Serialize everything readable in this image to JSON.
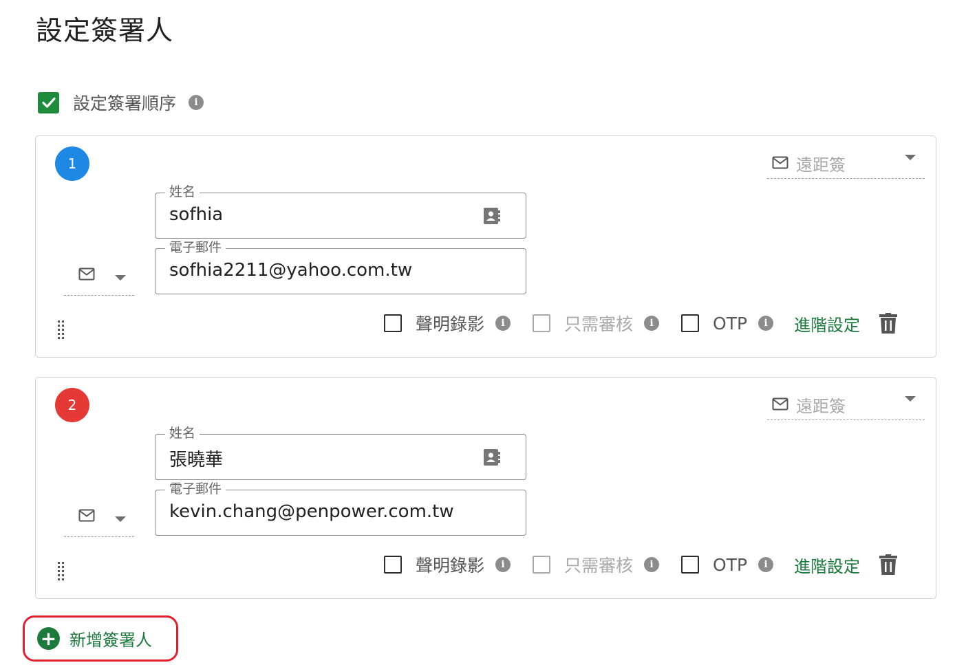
{
  "page_title": "設定簽署人",
  "signing_order": {
    "label": "設定簽署順序",
    "checked": true
  },
  "colors": {
    "accent_green": "#1b7a3c",
    "badge_blue": "#1e88e5",
    "badge_red": "#e53935",
    "highlight_red": "#e0202f"
  },
  "signers": [
    {
      "number": "1",
      "badge_color": "#1e88e5",
      "method": "遠距簽",
      "name_label": "姓名",
      "name_value": "sofhia",
      "email_label": "電子郵件",
      "email_value": "sofhia2211@yahoo.com.tw",
      "options": {
        "video": "聲明錄影",
        "review_only": "只需審核",
        "otp": "OTP"
      },
      "advanced": "進階設定"
    },
    {
      "number": "2",
      "badge_color": "#e53935",
      "method": "遠距簽",
      "name_label": "姓名",
      "name_value": "張曉華",
      "email_label": "電子郵件",
      "email_value": "kevin.chang@penpower.com.tw",
      "options": {
        "video": "聲明錄影",
        "review_only": "只需審核",
        "otp": "OTP"
      },
      "advanced": "進階設定"
    }
  ],
  "add_signer": {
    "label": "新增簽署人"
  },
  "icons": [
    "check-icon",
    "info-icon",
    "mail-icon",
    "chevron-down-icon",
    "contact-card-icon",
    "drag-handle-icon",
    "trash-icon",
    "plus-icon"
  ]
}
